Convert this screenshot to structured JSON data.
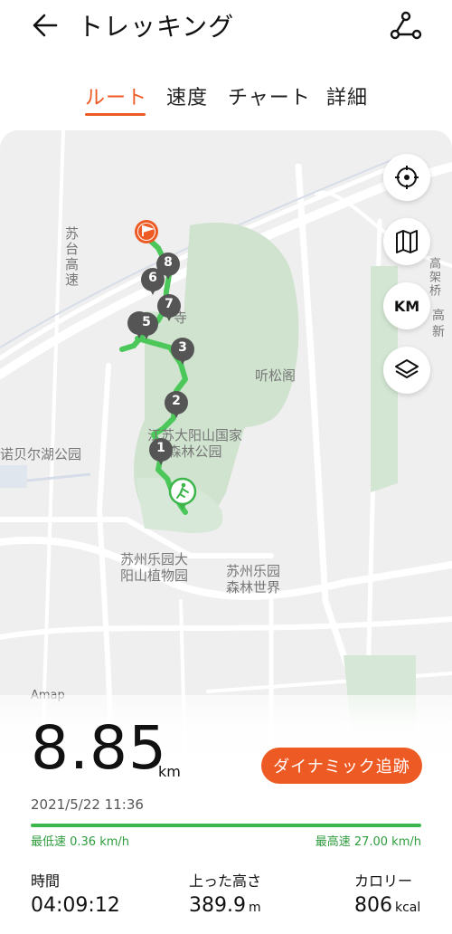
{
  "header": {
    "title": "トレッキング",
    "back_icon": "back-arrow-icon",
    "share_icon": "share-icon"
  },
  "tabs": [
    {
      "label": "ルート",
      "active": true
    },
    {
      "label": "速度",
      "active": false
    },
    {
      "label": "チャート",
      "active": false
    },
    {
      "label": "詳細",
      "active": false
    }
  ],
  "map": {
    "labels": {
      "expressway": "苏台高速",
      "park": "江苏大阳山国家森林公园",
      "tinsong": "听松阁",
      "nobel": "诺贝尔湖公园",
      "botanical": "苏州乐园大阳山植物园",
      "forest_world": "苏州乐园森林世界",
      "temple": "寺",
      "gaojia": "高架桥",
      "gaoxin": "高新"
    },
    "attribution": "Amap",
    "buttons": [
      "locate-icon",
      "map-style-icon",
      "km-marker-toggle",
      "layers-icon"
    ],
    "km_label": "KM",
    "km_markers": [
      "1",
      "2",
      "3",
      "4",
      "5",
      "6",
      "7",
      "8"
    ]
  },
  "summary": {
    "distance": "8.85",
    "distance_unit": "km",
    "dynamic_track_label": "ダイナミック追跡",
    "datetime": "2021/5/22 11:36",
    "min_speed": "最低速 0.36 km/h",
    "max_speed": "最高速 27.00 km/h"
  },
  "stats": {
    "time_label": "時間",
    "time_value": "04:09:12",
    "ascent_label": "上った高さ",
    "ascent_value": "389.9",
    "ascent_unit": "m",
    "calorie_label": "カロリー",
    "calorie_value": "806",
    "calorie_unit": "kcal"
  },
  "colors": {
    "accent": "#ee5a24",
    "route": "#4cc85a",
    "speed_bar": "#3cb54a"
  }
}
